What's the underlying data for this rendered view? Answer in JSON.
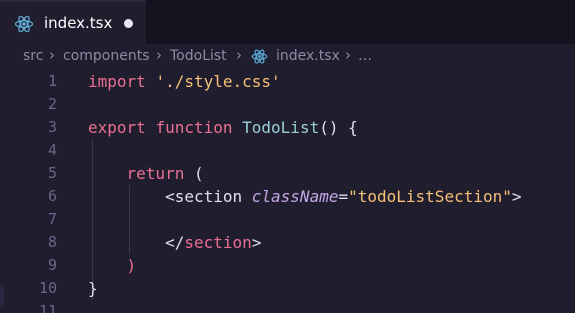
{
  "tab": {
    "label": "index.tsx",
    "icon": "react-icon",
    "modified": true
  },
  "breadcrumb": {
    "items": [
      "src",
      "components",
      "TodoList",
      "index.tsx",
      "…"
    ]
  },
  "editor": {
    "lines": [
      {
        "n": "1",
        "tokens": [
          {
            "t": "import ",
            "c": "kw"
          },
          {
            "t": "'./style.css'",
            "c": "str"
          }
        ]
      },
      {
        "n": "2",
        "tokens": []
      },
      {
        "n": "3",
        "tokens": [
          {
            "t": "export ",
            "c": "kw"
          },
          {
            "t": "function ",
            "c": "kw"
          },
          {
            "t": "TodoList",
            "c": "fn"
          },
          {
            "t": "() {",
            "c": "punc"
          }
        ]
      },
      {
        "n": "4",
        "tokens": []
      },
      {
        "n": "5",
        "tokens": [
          {
            "t": "    return ",
            "c": "kw"
          },
          {
            "t": "(",
            "c": "punc"
          }
        ]
      },
      {
        "n": "6",
        "tokens": [
          {
            "t": "        <",
            "c": "punc"
          },
          {
            "t": "section ",
            "c": "punc"
          },
          {
            "t": "className",
            "c": "attr"
          },
          {
            "t": "=",
            "c": "punc"
          },
          {
            "t": "\"todoListSection\"",
            "c": "str"
          },
          {
            "t": ">",
            "c": "punc"
          }
        ]
      },
      {
        "n": "7",
        "tokens": []
      },
      {
        "n": "8",
        "tokens": [
          {
            "t": "        </",
            "c": "punc"
          },
          {
            "t": "section",
            "c": "tag"
          },
          {
            "t": ">",
            "c": "punc"
          }
        ]
      },
      {
        "n": "9",
        "tokens": [
          {
            "t": "    )",
            "c": "kw"
          }
        ]
      },
      {
        "n": "10",
        "tokens": [
          {
            "t": "}",
            "c": "punc"
          }
        ]
      },
      {
        "n": "11",
        "tokens": []
      }
    ]
  }
}
